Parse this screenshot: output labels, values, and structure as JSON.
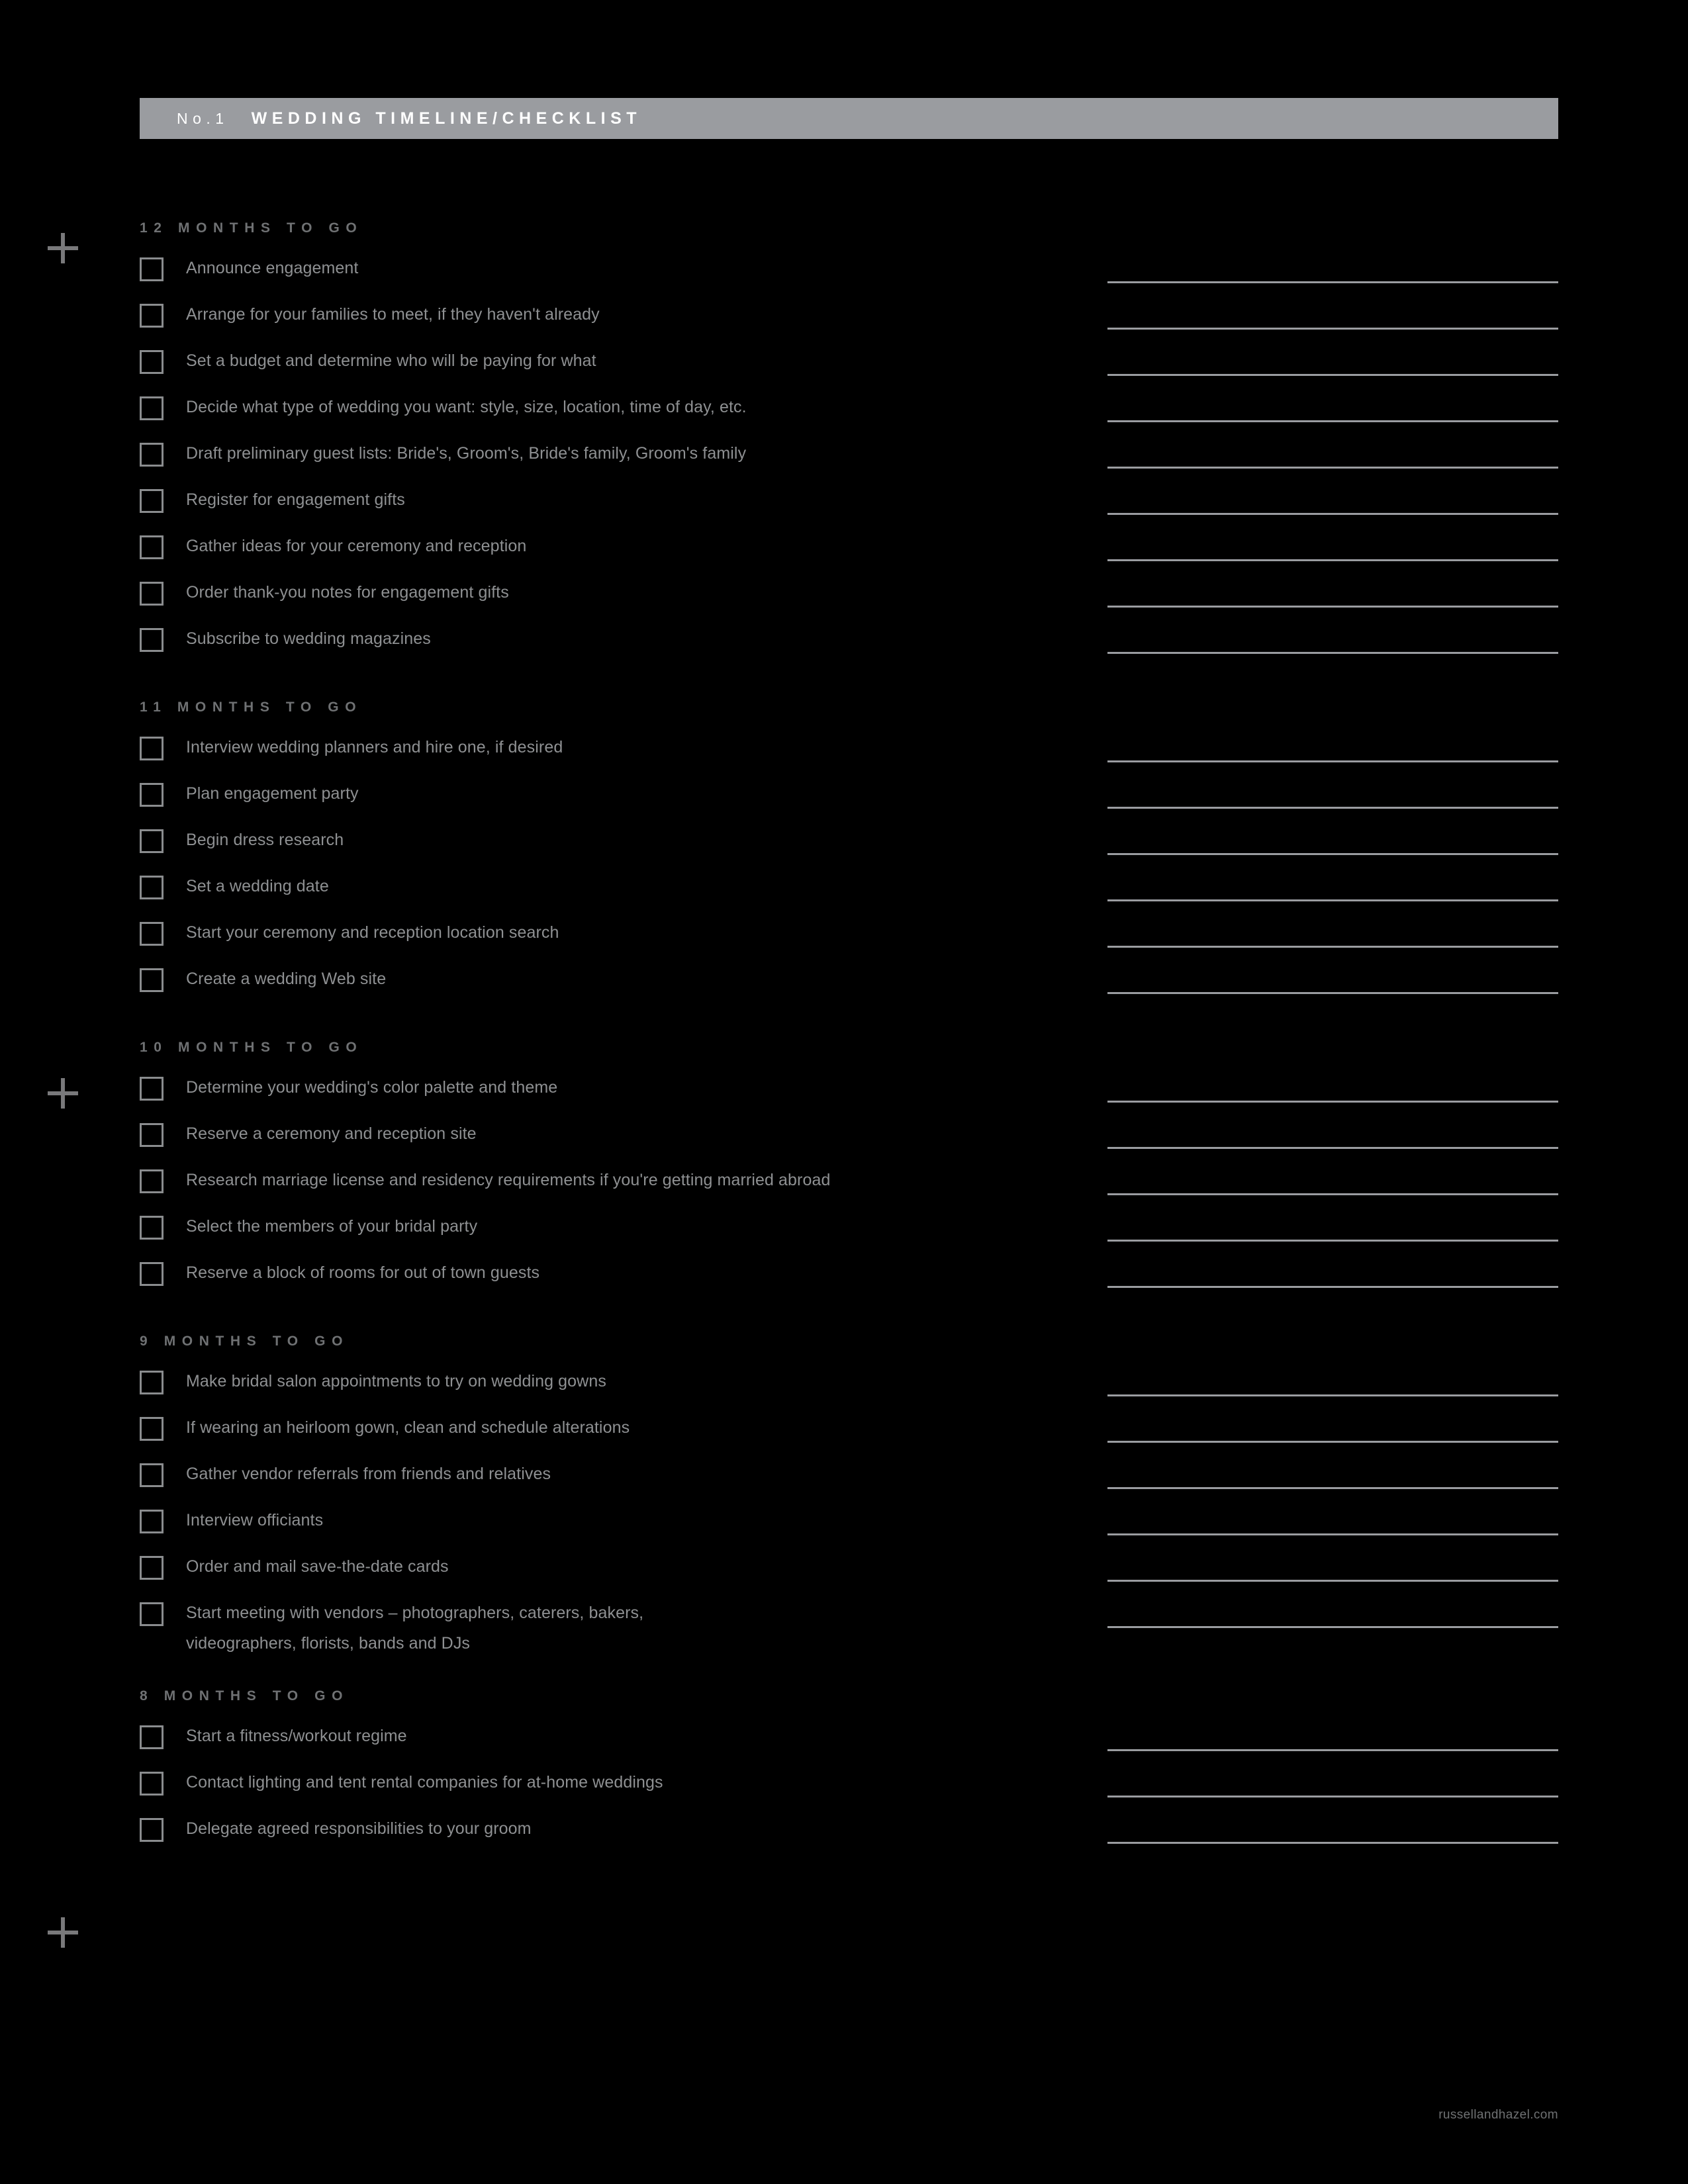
{
  "header": {
    "number": "No.1",
    "title": "WEDDING TIMELINE/CHECKLIST",
    "bar_color": "#9a9ca0",
    "text_color": "#ffffff"
  },
  "colors": {
    "background": "#000000",
    "heading": "#6f7173",
    "item_text": "#8e9092",
    "checkbox_border": "#8a8c8e",
    "rule": "#9a9ca0",
    "crop_mark": "#79797b"
  },
  "sections": [
    {
      "heading": "12 MONTHS TO GO",
      "items": [
        {
          "label": "Announce engagement",
          "checked": false,
          "rule": true
        },
        {
          "label": "Arrange for your families to meet, if they haven't already",
          "checked": false,
          "rule": true
        },
        {
          "label": "Set a budget and determine who will be paying for what",
          "checked": false,
          "rule": true
        },
        {
          "label": "Decide what type of wedding you want: style, size, location, time of day, etc.",
          "checked": false,
          "rule": true
        },
        {
          "label": "Draft preliminary guest lists: Bride's, Groom's, Bride's family, Groom's family",
          "checked": false,
          "rule": true
        },
        {
          "label": "Register for engagement gifts",
          "checked": false,
          "rule": true
        },
        {
          "label": "Gather ideas for your ceremony and reception",
          "checked": false,
          "rule": true
        },
        {
          "label": "Order thank-you notes for engagement gifts",
          "checked": false,
          "rule": true
        },
        {
          "label": "Subscribe to wedding magazines",
          "checked": false,
          "rule": true
        }
      ]
    },
    {
      "heading": "11 MONTHS TO GO",
      "items": [
        {
          "label": "Interview wedding planners and hire one, if desired",
          "checked": false,
          "rule": true
        },
        {
          "label": "Plan engagement party",
          "checked": false,
          "rule": true
        },
        {
          "label": "Begin dress research",
          "checked": false,
          "rule": true
        },
        {
          "label": "Set a wedding date",
          "checked": false,
          "rule": true
        },
        {
          "label": "Start your ceremony and reception location search",
          "checked": false,
          "rule": true
        },
        {
          "label": "Create a wedding Web site",
          "checked": false,
          "rule": true
        }
      ]
    },
    {
      "heading": "10 MONTHS TO GO",
      "items": [
        {
          "label": "Determine your wedding's color palette and theme",
          "checked": false,
          "rule": true
        },
        {
          "label": "Reserve a ceremony and reception site",
          "checked": false,
          "rule": true
        },
        {
          "label": "Research marriage license and residency requirements if you're getting married abroad",
          "checked": false,
          "rule": true
        },
        {
          "label": "Select the members of your bridal party",
          "checked": false,
          "rule": true
        },
        {
          "label": "Reserve a block of rooms for out of town guests",
          "checked": false,
          "rule": true
        }
      ]
    },
    {
      "heading": "9 MONTHS TO GO",
      "items": [
        {
          "label": "Make bridal salon appointments to try on wedding gowns",
          "checked": false,
          "rule": true
        },
        {
          "label": "If wearing an heirloom gown, clean and schedule alterations",
          "checked": false,
          "rule": true
        },
        {
          "label": "Gather vendor referrals from friends and relatives",
          "checked": false,
          "rule": true
        },
        {
          "label": "Interview officiants",
          "checked": false,
          "rule": true
        },
        {
          "label": "Order and mail save-the-date cards",
          "checked": false,
          "rule": true
        },
        {
          "label": "Start meeting with vendors – photographers, caterers, bakers,\nvideographers, florists, bands and DJs",
          "checked": false,
          "rule": true,
          "tall": true
        }
      ]
    },
    {
      "heading": "8 MONTHS TO GO",
      "items": [
        {
          "label": "Start a fitness/workout regime",
          "checked": false,
          "rule": true
        },
        {
          "label": "Contact lighting and tent rental companies for at-home weddings",
          "checked": false,
          "rule": true
        },
        {
          "label": "Delegate agreed responsibilities to your groom",
          "checked": false,
          "rule": true
        }
      ]
    }
  ],
  "crop_marks": [
    {
      "name": "crop-mark-top"
    },
    {
      "name": "crop-mark-middle"
    },
    {
      "name": "crop-mark-bottom"
    }
  ],
  "footer": {
    "url": "russellandhazel.com"
  }
}
